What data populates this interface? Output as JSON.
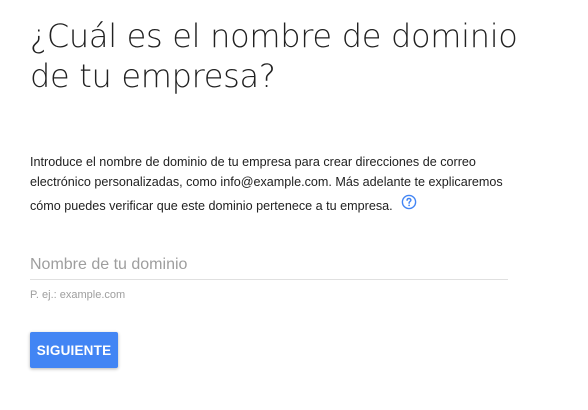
{
  "header": {
    "title_line1": "¿Cuál es el nombre de dominio",
    "title_line2": "de tu empresa?"
  },
  "description": {
    "text": "Introduce el nombre de dominio de tu empresa para crear direcciones de correo electrónico personalizadas, como info@example.com. Más adelante te explicaremos cómo puedes verificar que este dominio pertenece a tu empresa.",
    "help_icon": "help-circle-icon"
  },
  "domain_field": {
    "value": "",
    "placeholder": "Nombre de tu dominio",
    "hint": "P. ej.: example.com"
  },
  "actions": {
    "next_label": "SIGUIENTE"
  },
  "colors": {
    "accent": "#4285f4",
    "text": "#212121",
    "muted": "#9e9e9e",
    "divider": "#e0e0e0"
  }
}
